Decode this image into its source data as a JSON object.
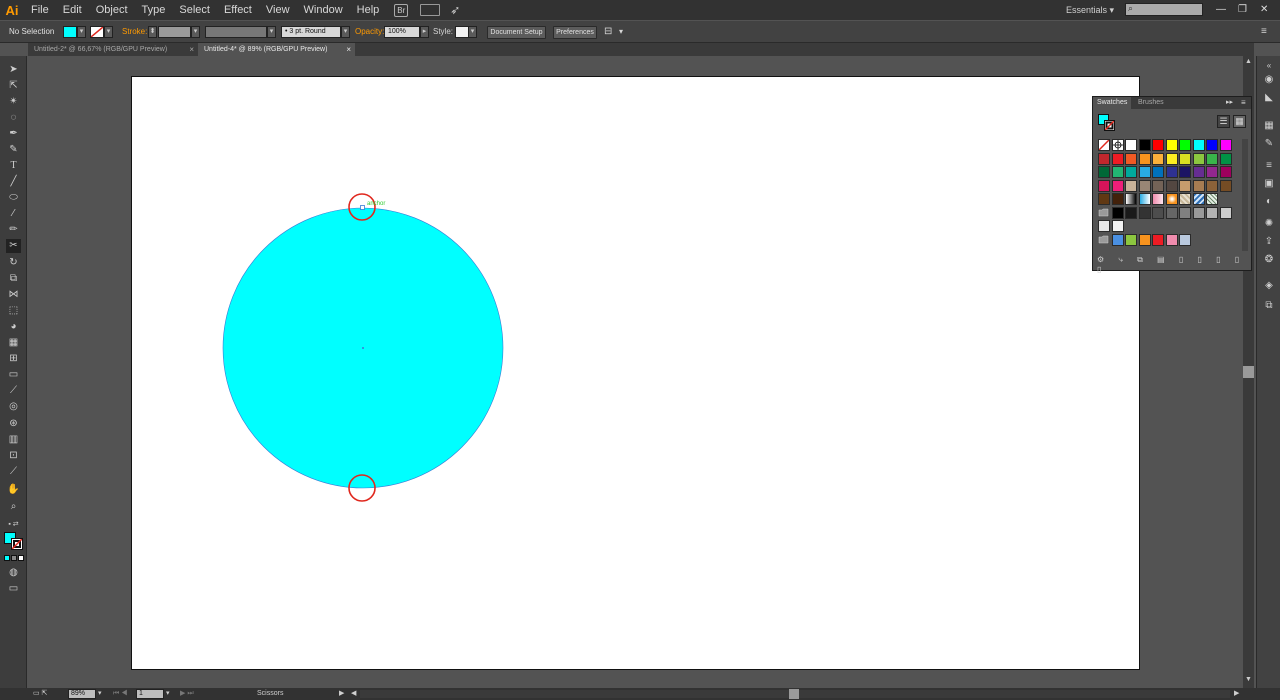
{
  "app": {
    "logo": "Ai"
  },
  "menu": [
    "File",
    "Edit",
    "Object",
    "Type",
    "Select",
    "Effect",
    "View",
    "Window",
    "Help"
  ],
  "menubar": {
    "bridge_label": "Br",
    "workspace": "Essentials",
    "search_placeholder": ""
  },
  "control": {
    "selection": "No Selection",
    "stroke_label": "Stroke:",
    "profile_value": "3 pt. Round",
    "opacity_label": "Opacity:",
    "opacity_value": "100%",
    "style_label": "Style:",
    "document_setup": "Document Setup",
    "preferences": "Preferences",
    "fill_color": "#00ffff",
    "accent": "#ff9a00"
  },
  "tabs": [
    {
      "label": "Untitled-2* @ 66,67% (RGB/GPU Preview)",
      "close": "×"
    },
    {
      "label": "Untitled-4* @ 89% (RGB/GPU Preview)",
      "close": "×"
    }
  ],
  "canvas": {
    "circle_fill": "#00ffff",
    "anchor_label": "anchor",
    "highlight_color": "#e0281e"
  },
  "status": {
    "zoom": "89%",
    "artboard": "1",
    "tool": "Scissors"
  },
  "swatches_panel": {
    "tab_swatches": "Swatches",
    "tab_brushes": "Brushes",
    "rows": [
      [
        "none",
        "reg",
        "#ffffff",
        "#000000",
        "#ff0000",
        "#ffff00",
        "#00ff00",
        "#00ffff",
        "#0000ff",
        "#ff00ff"
      ],
      [
        "#c1272d",
        "#ed1c24",
        "#f15a24",
        "#f7931e",
        "#fbb03b",
        "#fcee21",
        "#d9e021",
        "#8cc63f",
        "#39b54a",
        "#009245"
      ],
      [
        "#006837",
        "#22b573",
        "#00a99d",
        "#29abe2",
        "#0071bc",
        "#2e3192",
        "#1b1464",
        "#662d91",
        "#93278f",
        "#9e005d"
      ],
      [
        "#d4145a",
        "#ed1e79",
        "#c7b299",
        "#998675",
        "#736357",
        "#534741",
        "#c69c6d",
        "#a67c52",
        "#8c6239",
        "#754c24"
      ],
      [
        "#603813",
        "#42210b",
        "grad1",
        "grad2",
        "grad3",
        "grad4",
        "pat1",
        "pat2",
        "pat3",
        ""
      ],
      [
        "folder",
        "#000000",
        "#1a1a1a",
        "#333333",
        "#4d4d4d",
        "#666666",
        "#808080",
        "#999999",
        "#b3b3b3",
        "#cccccc"
      ],
      [
        "#e6e6e6",
        "#f2f2f2",
        "",
        "",
        "",
        "",
        "",
        "",
        "",
        ""
      ],
      [
        "folder",
        "#4a90e2",
        "#8cc63f",
        "#f7931e",
        "#ed1c24",
        "#f08cae",
        "#b9c9de",
        "",
        "",
        ""
      ]
    ]
  }
}
